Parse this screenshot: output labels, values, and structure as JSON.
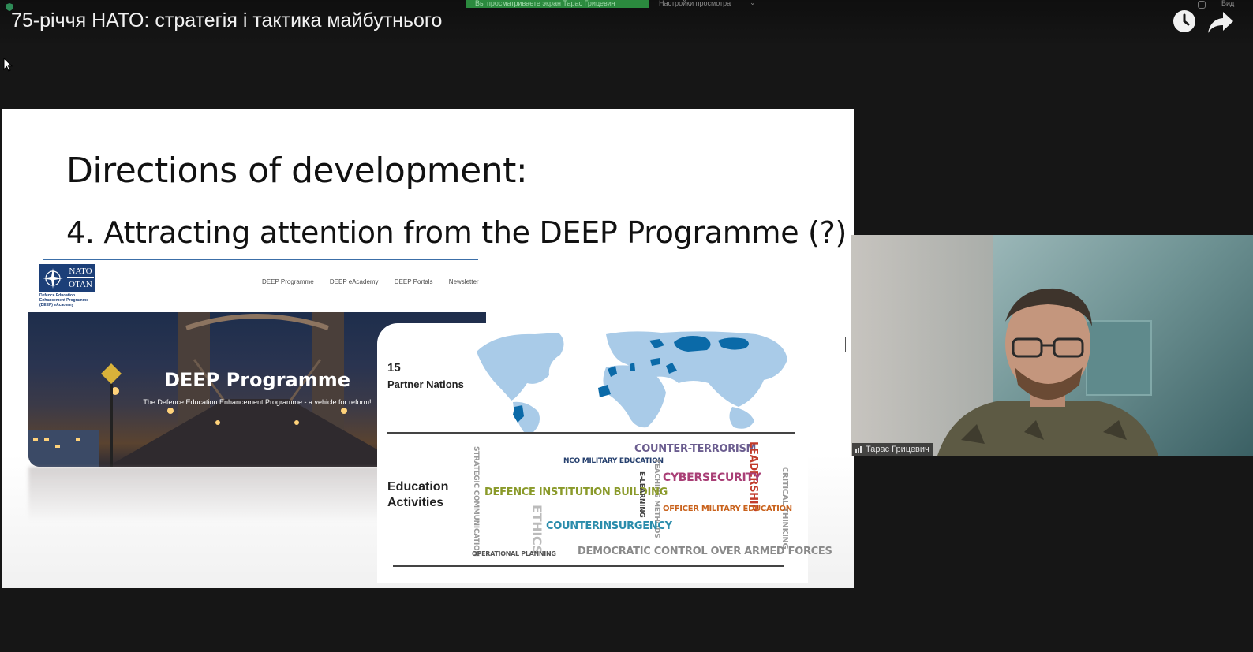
{
  "player": {
    "video_title": "75-річчя НАТО: стратегія і тактика майбутнього",
    "watch_later_icon": "clock-icon",
    "share_icon": "share-arrow-icon"
  },
  "zoom_bar": {
    "banner": "Вы просматриваете экран Тарас Грицевич",
    "view_options": "Настройки просмотра",
    "view_caret": "⌄",
    "right_label": "Вид"
  },
  "slide": {
    "heading": "Directions of development:",
    "subheading": "4. Attracting attention from the DEEP Programme (?)",
    "logo": {
      "line1": "NATO",
      "line2": "OTAN",
      "caption": "Defence Education Enhancement Programme (DEEP) eAcademy"
    },
    "nav": [
      "DEEP Programme",
      "DEEP eAcademy",
      "DEEP Portals",
      "Newsletter"
    ],
    "hero": {
      "title": "DEEP Programme",
      "subtitle": "The Defence Education Enhancement Programme - a vehicle for reform!"
    },
    "partners": {
      "count": "15",
      "label": "Partner Nations"
    },
    "education_label": "Education Activities",
    "word_cloud": {
      "counter_terrorism": "COUNTER-TERRORISM",
      "leadership": "LEADERSHIP",
      "nco": "NCO MILITARY EDUCATION",
      "strategic": "STRATEGIC COMMUNICATION",
      "teaching": "TEACHING METHODS",
      "cyber": "CYBERSECURITY",
      "critical": "CRITICAL THINKING",
      "dib": "DEFENCE INSTITUTION BUILDING",
      "elearning": "E-LEARNING",
      "officer": "OFFICER MILITARY EDUCATION",
      "ethics": "ETHICS",
      "coin": "COUNTERINSURGENCY",
      "opplan": "OPERATIONAL PLANNING",
      "democratic": "DEMOCRATIC CONTROL OVER ARMED FORCES"
    }
  },
  "participant": {
    "name": "Тарас Грицевич"
  },
  "colors": {
    "nato_blue": "#1c3f78",
    "map_highlight": "#0b6aa8",
    "map_land": "#a9cbe8"
  }
}
